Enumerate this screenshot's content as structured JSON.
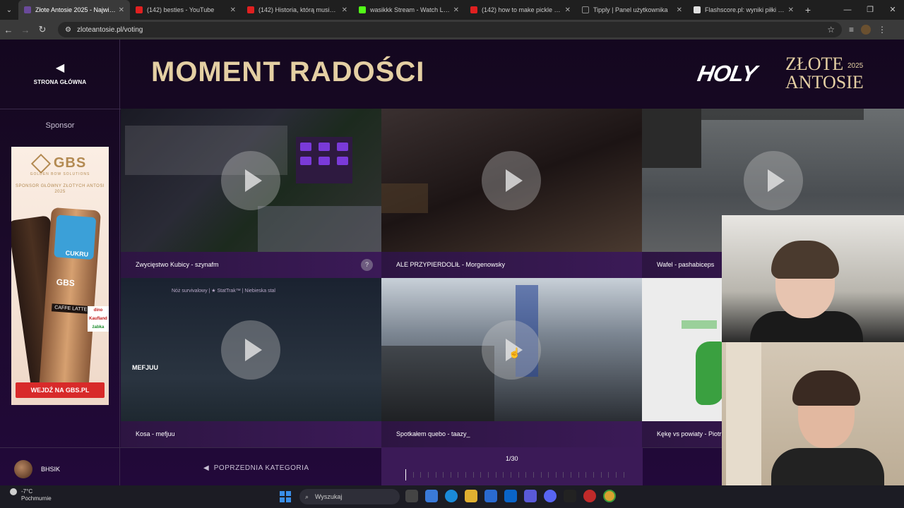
{
  "browser": {
    "tabs": [
      {
        "title": "Złote Antosie 2025 - Największ",
        "active": true,
        "color": "#6a4a9a"
      },
      {
        "title": "(142) besties - YouTube",
        "color": "#e02020"
      },
      {
        "title": "(142) Historia, którą musisz zna",
        "color": "#e02020"
      },
      {
        "title": "wasikkk Stream - Watch Live o",
        "color": "#53fc18"
      },
      {
        "title": "(142) how to make pickle peps",
        "color": "#e02020"
      },
      {
        "title": "Tipply | Panel użytkownika",
        "color": "#222222"
      },
      {
        "title": "Flashscore.pl: wyniki piłki nożn",
        "color": "#e0e0e0"
      }
    ],
    "url": "zloteantosie.pl/voting"
  },
  "site": {
    "back_label": "STRONA GŁÓWNA",
    "sponsor_label": "Sponsor",
    "page_title": "MOMENT RADOŚCI",
    "brand": {
      "holy": "HOLY",
      "line1": "ZŁOTE",
      "line2": "ANTOSIE",
      "year": "2025"
    },
    "ad": {
      "logo": "GBS",
      "sub": "GOLDEN BOW SOLUTIONS",
      "sponsor_text": "SPONSOR GŁÓWNY ZŁOTYCH ANTOSI 2025",
      "can_text": "CUKRU",
      "can_brand": "GBS",
      "flavor": "CAFFE LATTE",
      "shops": [
        "dino",
        "Kaufland",
        "żabka"
      ],
      "cta": "WEJDŹ NA GBS.PL"
    },
    "user": {
      "name": "BHSIK"
    },
    "clips": [
      {
        "caption": "Zwycięstwo Kubicy - szynafm"
      },
      {
        "caption": "ALE PRZYPIERDOLIŁ - Morgenowsky"
      },
      {
        "caption": "Wafel - pashabiceps"
      },
      {
        "caption": "Kosa - mefjuu",
        "overlay": "MEFJUU",
        "banner": "Nóż survivalowy | ★ StatTrak™ | Niebieska stal"
      },
      {
        "caption": "Spotkałem quebo - taazy_"
      },
      {
        "caption": "Kękę vs powiaty - Piotr"
      }
    ],
    "help": "?",
    "prev_category": "POPRZEDNIA KATEGORIA",
    "counter": "1/30"
  },
  "taskbar": {
    "temp": "-7°C",
    "weather": "Pochmurnie",
    "search_placeholder": "Wyszukaj"
  },
  "colors": {
    "accent_gold": "#e4cfa3",
    "bg_purple": "#22093a",
    "caption_purple": "#3b1a57"
  }
}
